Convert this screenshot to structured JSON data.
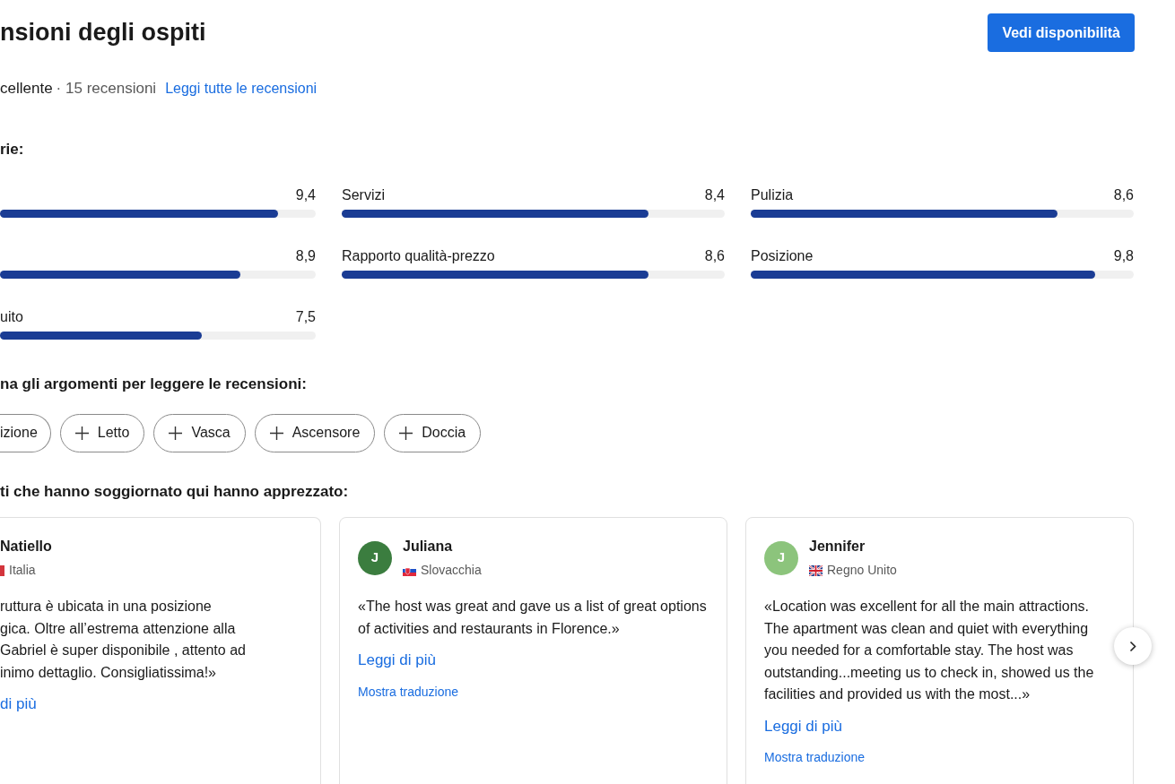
{
  "header": {
    "title": "nsioni degli ospiti",
    "button": "Vedi disponibilità"
  },
  "summary": {
    "rating_word": "cellente",
    "count": "· 15 recensioni",
    "link": "Leggi tutte le recensioni"
  },
  "categories_title": "rie:",
  "categories": [
    {
      "score": "9,4",
      "level": 0.88
    },
    {
      "label": "Servizi",
      "score": "8,4",
      "level": 0.8
    },
    {
      "label": "Pulizia",
      "score": "8,6",
      "level": 0.8
    },
    {
      "score": "8,9",
      "level": 0.76
    },
    {
      "label": "Rapporto qualità-prezzo",
      "score": "8,6",
      "level": 0.8
    },
    {
      "label": "Posizione",
      "score": "9,8",
      "level": 0.9
    },
    {
      "label": "uito",
      "score": "7,5",
      "level": 0.64
    }
  ],
  "topics_title": "na gli argomenti per leggere le recensioni:",
  "topics": [
    {
      "label": "izione",
      "kind": "partial"
    },
    {
      "label": "Letto",
      "kind": "add"
    },
    {
      "label": "Vasca",
      "kind": "add"
    },
    {
      "label": "Ascensore",
      "kind": "add"
    },
    {
      "label": "Doccia",
      "kind": "add"
    }
  ],
  "reviews_title": "ti che hanno soggiornato qui hanno apprezzato:",
  "reviews": [
    {
      "name": "Natiello",
      "country": "Italia",
      "flag": {
        "kind": "italy"
      },
      "text": "ruttura è ubicata in una posizione\ngica. Oltre all’estrema attenzione alla\n Gabriel è super disponibile , attento ad\ninimo dettaglio. Consigliatissima!»",
      "more": "di più"
    },
    {
      "name": "Juliana",
      "initial": "J",
      "color": "#3b7d3f",
      "country": "Slovacchia",
      "flag": {
        "kind": "slovakia"
      },
      "text": "«The host was great and gave us a list of great options of activities and restaurants in Florence.»",
      "more": "Leggi di più",
      "translate": "Mostra traduzione"
    },
    {
      "name": "Jennifer",
      "initial": "J",
      "color": "#8cc47c",
      "country": "Regno Unito",
      "flag": {
        "kind": "uk"
      },
      "text": "«Location was excellent for all the main attractions. The apartment was clean and quiet with everything you needed for a comfortable stay. The host was outstanding...meeting us to check in, showed us the facilities and provided us with the most...»",
      "more": "Leggi di più",
      "translate": "Mostra traduzione"
    }
  ]
}
